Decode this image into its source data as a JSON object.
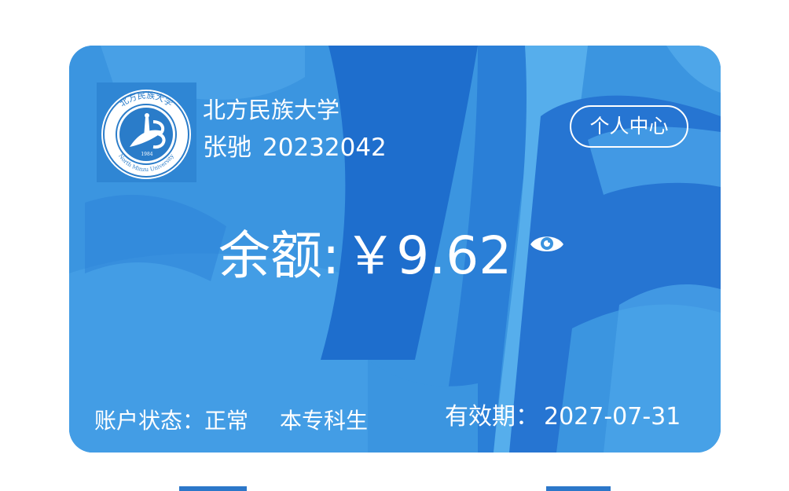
{
  "card": {
    "school_name": "北方民族大学",
    "logo": {
      "ring_text": "北方民族大学",
      "ring_text_en": "North Minzu University",
      "year": "1984"
    },
    "user_name": "张驰",
    "student_id": "20232042",
    "personal_center_label": "个人中心",
    "balance_label": "余额:",
    "balance_amount": "￥9.62",
    "show_balance_icon": "eye-icon",
    "account_status": "账户状态：正常",
    "student_type": "本专科生",
    "validity": "有效期：",
    "validity_date": "2027-07-31"
  },
  "colors": {
    "card_base": "#3a93df",
    "card_dark": "#1f6fcf",
    "card_light": "#5fb0ee",
    "text": "#ffffff"
  }
}
